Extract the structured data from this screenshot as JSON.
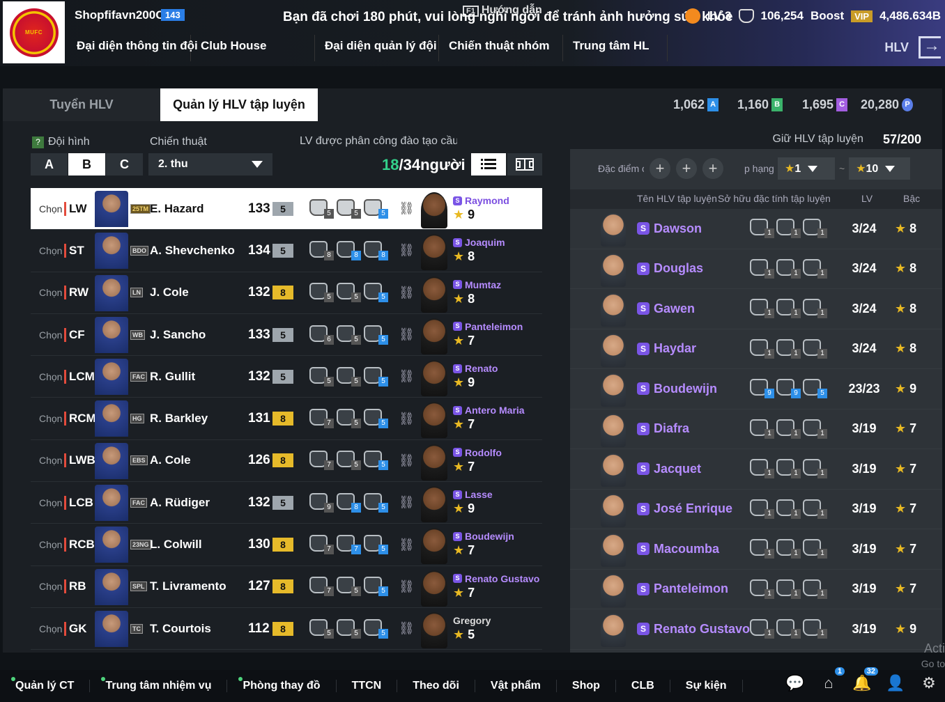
{
  "header": {
    "username": "Shopfifavn200C",
    "user_level": "143",
    "notice": "Bạn đã chơi 180 phút, vui lòng nghỉ ngơi để tránh ảnh hưởng sức khỏe",
    "guide_label": "Hướng dẫn",
    "lv": "LV 3",
    "coins": "106,254",
    "boost_label": "Boost",
    "vip_label": "VIP",
    "bp": "4,486.634B",
    "nav": [
      "Đại diện thông tin đội",
      "Club House",
      "Đại diện quản lý đội",
      "Chiến thuật nhóm",
      "Trung tâm HL"
    ],
    "hlv_label": "HLV"
  },
  "tabs": {
    "recruit": "Tuyển HLV",
    "manage": "Quản lý HLV tập luyện"
  },
  "resources": [
    {
      "value": "1,062",
      "tag": "A",
      "color": "#2d8fe8"
    },
    {
      "value": "1,160",
      "tag": "B",
      "color": "#3bb36b"
    },
    {
      "value": "1,695",
      "tag": "C",
      "color": "#a35ee0"
    },
    {
      "value": "20,280",
      "tag": "P",
      "color": "#5b7ee8"
    }
  ],
  "left": {
    "formation_label": "Đội hình",
    "formation_help": "?",
    "formations": [
      "A",
      "B",
      "C"
    ],
    "tactic_label": "Chiến thuật",
    "tactic_value": "2. thu",
    "assign_label": "LV được phân công đào tạo cầu thủ",
    "assign_current": "18",
    "assign_total": "/34người"
  },
  "players": [
    {
      "chon": "Chọn",
      "pos": "LW",
      "badge": "25TM",
      "name": "E. Hazard",
      "ovr": "133",
      "grade": "5",
      "skills": [
        "5",
        "5",
        "5"
      ],
      "coach": "Raymond",
      "star": "9",
      "sel": true
    },
    {
      "chon": "Chọn",
      "pos": "ST",
      "badge": "BDO",
      "name": "A. Shevchenko",
      "ovr": "134",
      "grade": "5",
      "skills": [
        "8",
        "8",
        "8"
      ],
      "coach": "Joaquim",
      "star": "8"
    },
    {
      "chon": "Chọn",
      "pos": "RW",
      "badge": "LN",
      "name": "J. Cole",
      "ovr": "132",
      "grade": "8",
      "skills": [
        "5",
        "5",
        "5"
      ],
      "coach": "Mumtaz",
      "star": "8"
    },
    {
      "chon": "Chọn",
      "pos": "CF",
      "badge": "WB",
      "name": "J. Sancho",
      "ovr": "133",
      "grade": "5",
      "skills": [
        "6",
        "5",
        "5"
      ],
      "coach": "Panteleimon",
      "star": "7"
    },
    {
      "chon": "Chọn",
      "pos": "LCM",
      "badge": "FAC",
      "name": "R. Gullit",
      "ovr": "132",
      "grade": "5",
      "skills": [
        "5",
        "5",
        "5"
      ],
      "coach": "Renato",
      "star": "9"
    },
    {
      "chon": "Chọn",
      "pos": "RCM",
      "badge": "HG",
      "name": "R. Barkley",
      "ovr": "131",
      "grade": "8",
      "skills": [
        "7",
        "5",
        "5"
      ],
      "coach": "Antero Maria",
      "star": "7"
    },
    {
      "chon": "Chọn",
      "pos": "LWB",
      "badge": "EBS",
      "name": "A. Cole",
      "ovr": "126",
      "grade": "8",
      "skills": [
        "7",
        "5",
        "5"
      ],
      "coach": "Rodolfo",
      "star": "7"
    },
    {
      "chon": "Chọn",
      "pos": "LCB",
      "badge": "FAC",
      "name": "A. Rüdiger",
      "ovr": "132",
      "grade": "5",
      "skills": [
        "9",
        "8",
        "5"
      ],
      "coach": "Lasse",
      "star": "9"
    },
    {
      "chon": "Chọn",
      "pos": "RCB",
      "badge": "23NG",
      "name": "L. Colwill",
      "ovr": "130",
      "grade": "8",
      "skills": [
        "7",
        "7",
        "5"
      ],
      "coach": "Boudewijn",
      "star": "7"
    },
    {
      "chon": "Chọn",
      "pos": "RB",
      "badge": "SPL",
      "name": "T. Livramento",
      "ovr": "127",
      "grade": "8",
      "skills": [
        "7",
        "5",
        "5"
      ],
      "coach": "Renato Gustavo",
      "star": "7"
    },
    {
      "chon": "Chọn",
      "pos": "GK",
      "badge": "TC",
      "name": "T. Courtois",
      "ovr": "112",
      "grade": "8",
      "skills": [
        "5",
        "5",
        "5"
      ],
      "coach": "Gregory",
      "star": "5",
      "plain": true
    }
  ],
  "right": {
    "hold_label": "Giữ HLV tập luyện",
    "hold_value": "57/200",
    "trait_label": "Đặc điểm c",
    "rank_label": "p hạng",
    "rank_from": "1",
    "rank_to": "10",
    "range_sep": "~",
    "col_name": "Tên HLV tập luyện",
    "col_trait": "Sở hữu đặc tính tập luyện",
    "col_lv": "LV",
    "col_rank": "Bậc"
  },
  "coaches": [
    {
      "name": "Dawson",
      "skills": [
        "1",
        "1",
        "1"
      ],
      "lv": "3/24",
      "rank": "8"
    },
    {
      "name": "Douglas",
      "skills": [
        "1",
        "1",
        "1"
      ],
      "lv": "3/24",
      "rank": "8"
    },
    {
      "name": "Gawen",
      "skills": [
        "1",
        "1",
        "1"
      ],
      "lv": "3/24",
      "rank": "8"
    },
    {
      "name": "Haydar",
      "skills": [
        "1",
        "1",
        "1"
      ],
      "lv": "3/24",
      "rank": "8"
    },
    {
      "name": "Boudewijn",
      "skills": [
        "9",
        "9",
        "5"
      ],
      "lv": "23/23",
      "rank": "9"
    },
    {
      "name": "Diafra",
      "skills": [
        "1",
        "1",
        "1"
      ],
      "lv": "3/19",
      "rank": "7"
    },
    {
      "name": "Jacquet",
      "skills": [
        "1",
        "1",
        "1"
      ],
      "lv": "3/19",
      "rank": "7"
    },
    {
      "name": "José Enrique",
      "skills": [
        "1",
        "1",
        "1"
      ],
      "lv": "3/19",
      "rank": "7"
    },
    {
      "name": "Macoumba",
      "skills": [
        "1",
        "1",
        "1"
      ],
      "lv": "3/19",
      "rank": "7"
    },
    {
      "name": "Panteleimon",
      "skills": [
        "1",
        "1",
        "1"
      ],
      "lv": "3/19",
      "rank": "7"
    },
    {
      "name": "Renato Gustavo",
      "skills": [
        "1",
        "1",
        "1"
      ],
      "lv": "3/19",
      "rank": "9"
    }
  ],
  "bottom_nav": [
    "Quản lý CT",
    "Trung tâm nhiệm vụ",
    "Phòng thay đồ",
    "TTCN",
    "Theo dõi",
    "Vật phẩm",
    "Shop",
    "CLB",
    "Sự kiện"
  ],
  "bottom_counts": {
    "home": "1",
    "bell": "32"
  },
  "watermark": {
    "line1": "Acti",
    "line2": "Go to"
  }
}
